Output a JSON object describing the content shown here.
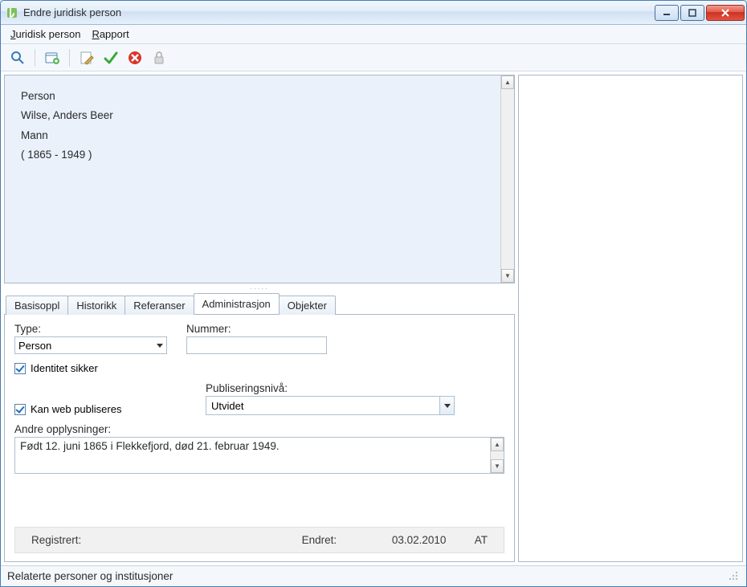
{
  "window": {
    "title": "Endre juridisk person"
  },
  "menubar": {
    "items": [
      {
        "label": "Juridisk person",
        "accel_index": 0
      },
      {
        "label": "Rapport",
        "accel_index": 0
      }
    ]
  },
  "toolbar": {
    "icons": [
      "search-icon",
      "new-record-icon",
      "edit-record-icon",
      "ok-icon",
      "cancel-icon",
      "lock-icon"
    ]
  },
  "summary": {
    "lines": [
      "Person",
      "Wilse, Anders Beer",
      "Mann",
      "( 1865 - 1949 )"
    ]
  },
  "tabs": [
    {
      "label": "Basisoppl"
    },
    {
      "label": "Historikk"
    },
    {
      "label": "Referanser"
    },
    {
      "label": "Administrasjon",
      "active": true
    },
    {
      "label": "Objekter"
    }
  ],
  "form": {
    "type_label": "Type:",
    "type_value": "Person",
    "number_label": "Nummer:",
    "number_value": "",
    "identity_secure_label": "Identitet sikker",
    "identity_secure_checked": true,
    "web_publish_label": "Kan web publiseres",
    "web_publish_checked": true,
    "publish_level_label": "Publiseringsnivå:",
    "publish_level_value": "Utvidet",
    "other_info_label": "Andre opplysninger:",
    "other_info_value": "Født 12. juni 1865 i Flekkefjord, død 21. februar 1949."
  },
  "record_info": {
    "registered_label": "Registrert:",
    "changed_label": "Endret:",
    "changed_date": "03.02.2010",
    "changed_by": "AT"
  },
  "statusbar": {
    "text": "Relaterte personer og institusjoner"
  }
}
